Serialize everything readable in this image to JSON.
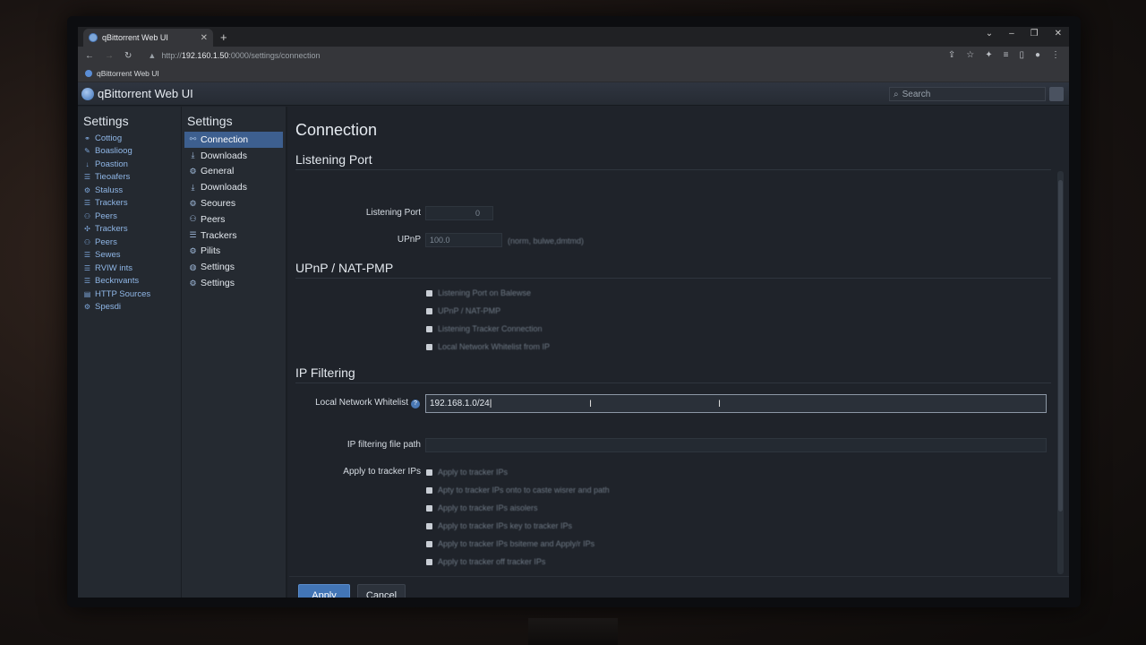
{
  "browser": {
    "tab_title": "qBittorrent Web UI",
    "new_tab": "+",
    "url_scheme": "http://",
    "url_host": "192.160.1.50",
    "url_rest": ":0000/settings/connection",
    "bookmark": "qBittorrent Web UI"
  },
  "app": {
    "title": "qBittorrent Web UI",
    "search_placeholder": "Search"
  },
  "sidebar": {
    "title": "Settings",
    "items": [
      {
        "icon": "link-icon",
        "label": "Cottiog"
      },
      {
        "icon": "pencil-icon",
        "label": "Boaslioog"
      },
      {
        "icon": "arrow-down-icon",
        "label": "Poastion"
      },
      {
        "icon": "list-icon",
        "label": "Tieoafers"
      },
      {
        "icon": "gear-icon",
        "label": "Staluss"
      },
      {
        "icon": "list-icon",
        "label": "Trackers"
      },
      {
        "icon": "peers-icon",
        "label": "Peers"
      },
      {
        "icon": "tracker-icon",
        "label": "Trackers"
      },
      {
        "icon": "peers-icon",
        "label": "Peers"
      },
      {
        "icon": "list-icon",
        "label": "Sewes"
      },
      {
        "icon": "list-icon",
        "label": "RVIW ints"
      },
      {
        "icon": "list-icon",
        "label": "Becknvants"
      },
      {
        "icon": "box-icon",
        "label": "HTTP Sources"
      },
      {
        "icon": "gear-icon",
        "label": "Spesdi"
      }
    ]
  },
  "settings_nav": {
    "title": "Settings",
    "items": [
      {
        "icon": "connection-icon",
        "label": "Connection",
        "active": true
      },
      {
        "icon": "download-icon",
        "label": "Downloads"
      },
      {
        "icon": "general-icon",
        "label": "General"
      },
      {
        "icon": "download-icon",
        "label": "Downloads"
      },
      {
        "icon": "gear-icon",
        "label": "Seoures"
      },
      {
        "icon": "peers-icon",
        "label": "Peers"
      },
      {
        "icon": "list-icon",
        "label": "Trackers"
      },
      {
        "icon": "gear-icon",
        "label": "Pilits"
      },
      {
        "icon": "globe-icon",
        "label": "Settings"
      },
      {
        "icon": "gear-icon",
        "label": "Settings"
      }
    ]
  },
  "main": {
    "title": "Connection",
    "listening": {
      "heading": "Listening Port",
      "port_label": "Listening Port",
      "port_value": "0",
      "upnp_label": "UPnP",
      "upnp_value": "100.0",
      "upnp_hint": "(norm, bulwe,dmtmd)"
    },
    "upnp": {
      "heading": "UPnP / NAT-PMP",
      "options": [
        "Listening Port on Balewse",
        "UPnP / NAT-PMP",
        "Listening Tracker Connection",
        "Local Network Whitelist from IP"
      ]
    },
    "ipfilter": {
      "heading": "IP Filtering",
      "whitelist_label": "Local Network Whitelist",
      "whitelist_value": "192.168.1.0/24",
      "filepath_label": "IP filtering file path",
      "filepath_value": "",
      "tracker_label": "Apply to tracker IPs",
      "tracker_options": [
        "Apply to tracker IPs",
        "Apty to tracker IPs onto to caste wisrer and path",
        "Apply to tracker IPs aisolers",
        "Apply to tracker IPs key to tracker IPs",
        "Apply to tracker IPs bsiteme and Apply/r IPs",
        "Apply to tracker off tracker IPs"
      ]
    }
  },
  "footer": {
    "apply": "Apply",
    "cancel": "Cancel"
  },
  "colors": {
    "accent": "#4275b6",
    "active_nav": "#3d5f8f",
    "link": "#8fb6e6"
  }
}
